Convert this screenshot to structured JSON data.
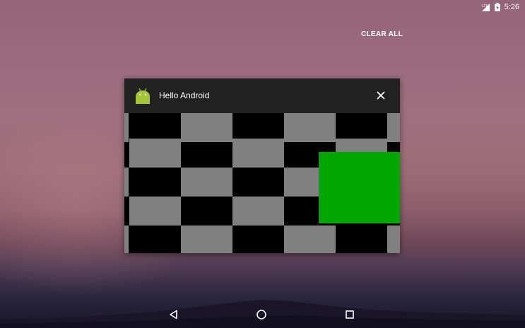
{
  "status_bar": {
    "time": "5:26",
    "icons": [
      "signal-lte-icon",
      "battery-charging-icon"
    ]
  },
  "recents": {
    "clear_all_label": "CLEAR ALL"
  },
  "app_card": {
    "title": "Hello Android",
    "icon": "android-icon",
    "close_icon": "close-icon",
    "thumbnail": {
      "checker_colors": [
        "#000000",
        "#808080"
      ],
      "overlay_color": "#00a800"
    }
  },
  "nav_bar": {
    "buttons": [
      "back-icon",
      "home-icon",
      "recents-icon"
    ]
  }
}
